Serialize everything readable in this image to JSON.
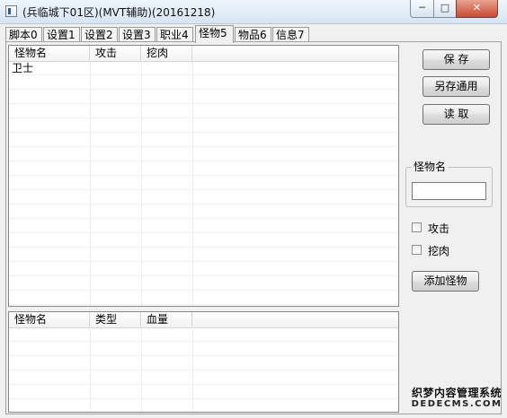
{
  "window": {
    "title": "(兵临城下01区)(MVT辅助)(20161218)",
    "min_glyph": "─",
    "max_glyph": "□",
    "close_glyph": "✕"
  },
  "tabs": [
    {
      "label": "脚本0"
    },
    {
      "label": "设置1"
    },
    {
      "label": "设置2"
    },
    {
      "label": "设置3"
    },
    {
      "label": "职业4"
    },
    {
      "label": "怪物5",
      "active": true
    },
    {
      "label": "物品6"
    },
    {
      "label": "信息7"
    }
  ],
  "monster_list": {
    "columns": [
      "怪物名",
      "攻击",
      "挖肉"
    ],
    "rows": [
      {
        "name": "卫士",
        "attack": "",
        "dig": ""
      }
    ]
  },
  "bottom_list": {
    "columns": [
      "怪物名",
      "类型",
      "血量"
    ],
    "rows": []
  },
  "buttons": {
    "save": "保 存",
    "save_as_common": "另存通用",
    "read": "读 取",
    "add_monster": "添加怪物"
  },
  "monster_name_group": {
    "label": "怪物名",
    "input_value": ""
  },
  "checkboxes": {
    "attack": {
      "label": "攻击",
      "checked": false
    },
    "dig": {
      "label": "挖肉",
      "checked": false
    }
  },
  "watermark": {
    "line1": "织梦内容管理系统",
    "line2": "DEDECMS.COM"
  }
}
